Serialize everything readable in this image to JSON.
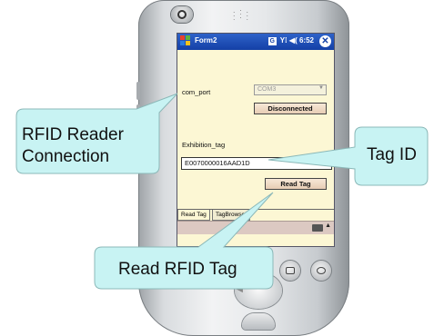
{
  "window": {
    "title": "Form2",
    "clock": "6:52",
    "taskbar_badge": "G"
  },
  "form": {
    "port_label": "com_port",
    "port_value": "COM3",
    "connect_button": "Disconnected",
    "tag_label": "Exhibition_tag",
    "tag_value": "E0070000016AAD1D",
    "read_button": "Read Tag"
  },
  "tabs": [
    {
      "label": "Read Tag"
    },
    {
      "label": "TagBrowser"
    }
  ],
  "callouts": {
    "reader": {
      "line1": "RFID Reader",
      "line2": "Connection"
    },
    "tag_id": "Tag ID",
    "read": "Read RFID Tag"
  },
  "icons": [
    "windows-logo-icon",
    "signal-icon",
    "speaker-icon",
    "close-icon",
    "keyboard-icon",
    "calendar-icon",
    "mail-icon",
    "power-icon"
  ],
  "colors": {
    "screen_bg": "#fcf7d4",
    "titlebar": "#1440a6",
    "callout_fill": "#c8f3f3",
    "callout_stroke": "#8bb8b8"
  }
}
